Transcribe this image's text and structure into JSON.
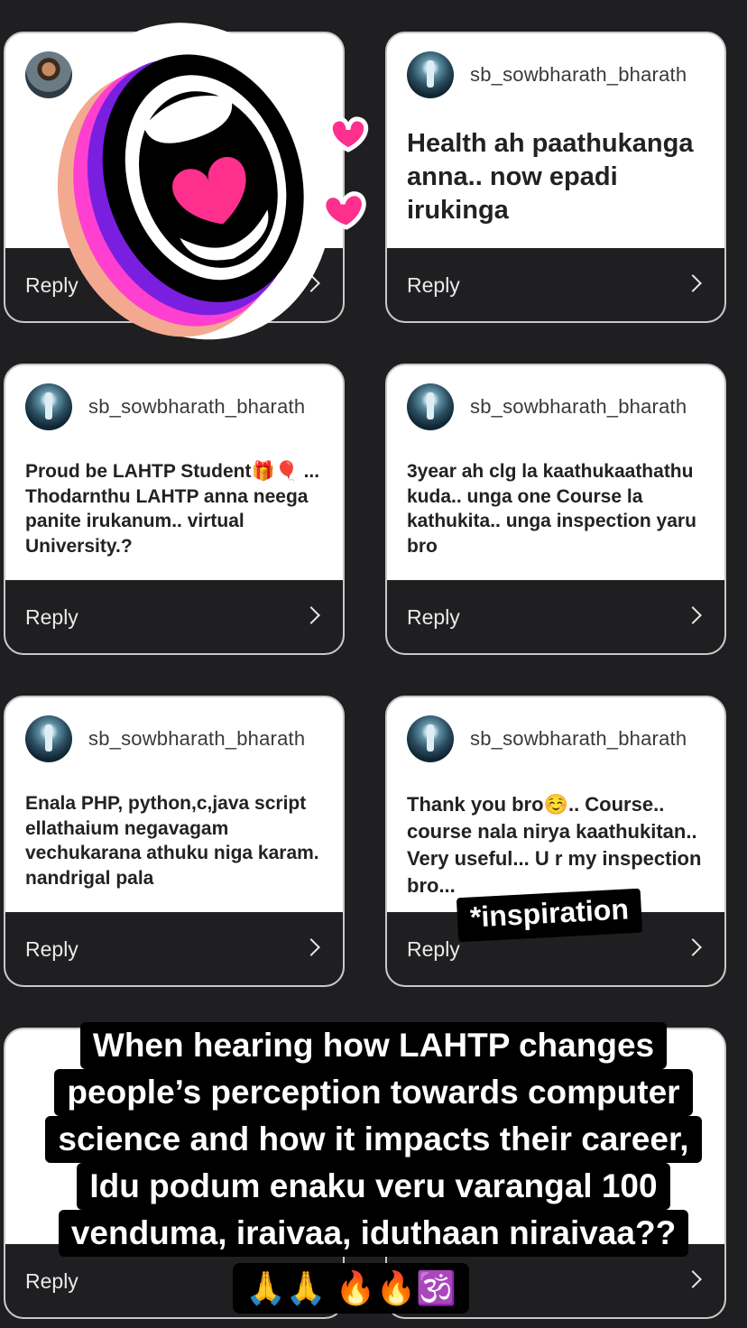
{
  "cards": [
    {
      "username": "",
      "text": "",
      "reply_label": "Reply",
      "avatar": "person"
    },
    {
      "username": "sb_sowbharath_bharath",
      "text": "Health ah paathukanga anna.. now epadi irukinga",
      "reply_label": "Reply",
      "avatar": "logo"
    },
    {
      "username": "sb_sowbharath_bharath",
      "text": "Proud be LAHTP Student🎁🎈 ...  Thodarnthu LAHTP anna neega panite irukanum.. virtual University.?",
      "reply_label": "Reply",
      "avatar": "logo"
    },
    {
      "username": "sb_sowbharath_bharath",
      "text": "3year ah clg la kaathukaathathu kuda.. unga one Course la kathukita.. unga inspection yaru bro",
      "reply_label": "Reply",
      "avatar": "logo"
    },
    {
      "username": "sb_sowbharath_bharath",
      "text": "Enala PHP, python,c,java script ellathaium negavagam vechukarana athuku niga karam. nandrigal pala",
      "reply_label": "Reply",
      "avatar": "logo"
    },
    {
      "username": "sb_sowbharath_bharath",
      "text": "Thank you bro☺️..  Course..  course nala nirya kaathukitan.. Very useful... U r my inspection bro...",
      "reply_label": "Reply",
      "avatar": "logo"
    },
    {
      "username": "",
      "text": "",
      "reply_label": "Reply",
      "avatar": "logo"
    },
    {
      "username": "",
      "text": "",
      "reply_label": "",
      "avatar": "logo"
    }
  ],
  "tag_text": "*inspiration",
  "caption_lines": [
    "When hearing how LAHTP changes",
    "people’s perception towards computer",
    "science and how it impacts their career,",
    "Idu podum enaku veru varangal 100",
    "venduma, iraivaa, iduthaan niraivaa??"
  ],
  "emoji_line": "🙏🙏 🔥🔥🕉️",
  "icons": {
    "sticker": "screaming-mouth-heart-sticker",
    "chevron": "chevron-right-icon"
  }
}
